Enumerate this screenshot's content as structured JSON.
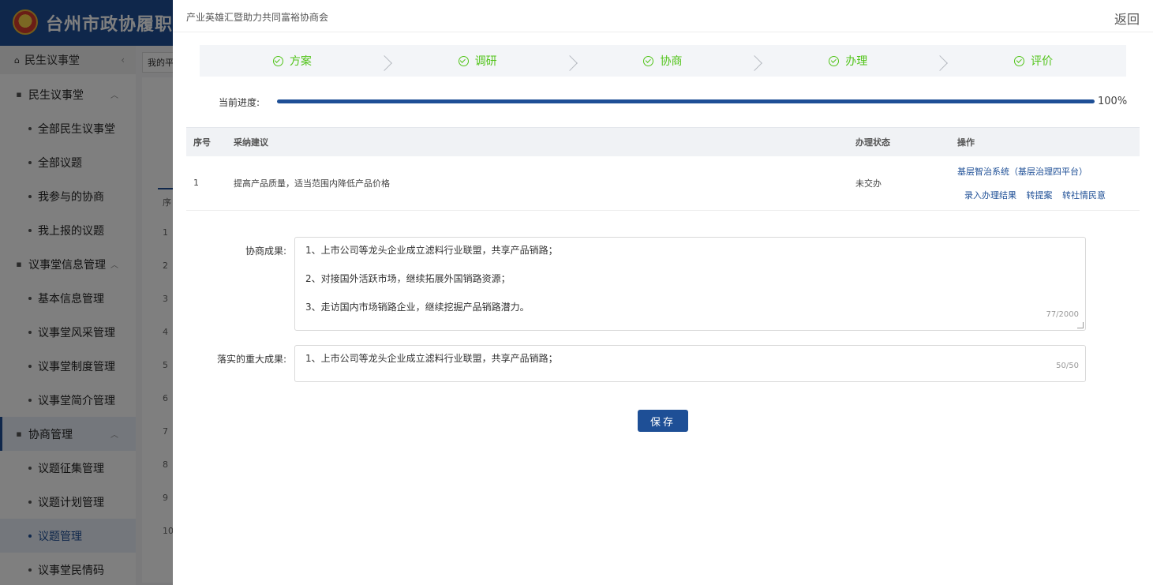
{
  "app": {
    "title": "台州市政协履职服"
  },
  "sidebar": {
    "header": "民生议事堂",
    "items": [
      {
        "type": "group",
        "label": "民生议事堂"
      },
      {
        "type": "sub",
        "label": "全部民生议事堂"
      },
      {
        "type": "sub",
        "label": "全部议题"
      },
      {
        "type": "sub",
        "label": "我参与的协商"
      },
      {
        "type": "sub",
        "label": "我上报的议题"
      },
      {
        "type": "group",
        "label": "议事堂信息管理"
      },
      {
        "type": "sub",
        "label": "基本信息管理"
      },
      {
        "type": "sub",
        "label": "议事堂风采管理"
      },
      {
        "type": "sub",
        "label": "议事堂制度管理"
      },
      {
        "type": "sub",
        "label": "议事堂简介管理"
      },
      {
        "type": "group",
        "label": "协商管理"
      },
      {
        "type": "sub",
        "label": "议题征集管理"
      },
      {
        "type": "sub",
        "label": "议题计划管理"
      },
      {
        "type": "sub",
        "label": "议题管理"
      },
      {
        "type": "sub",
        "label": "议事堂民情码"
      }
    ]
  },
  "background": {
    "tab_label": "我的平",
    "col_header": "序",
    "row_numbers": [
      "1",
      "2",
      "3",
      "4",
      "5",
      "6",
      "7",
      "8",
      "9",
      "10"
    ]
  },
  "drawer": {
    "title": "产业英雄汇暨助力共同富裕协商会",
    "back_label": "返回",
    "steps": [
      "方案",
      "调研",
      "协商",
      "办理",
      "评价"
    ],
    "progress": {
      "label": "当前进度:",
      "value": 100,
      "text": "100%"
    },
    "table": {
      "headers": {
        "index": "序号",
        "suggestion": "采纳建议",
        "status": "办理状态",
        "ops": "操作"
      },
      "rows": [
        {
          "index": "1",
          "suggestion": "提高产品质量，适当范围内降低产品价格",
          "status": "未交办",
          "system": "基层智治系统（基层治理四平台）",
          "actions": [
            "录入办理结果",
            "转提案",
            "转社情民意"
          ]
        }
      ]
    },
    "outcome": {
      "label": "协商成果:",
      "lines": [
        "1、上市公司等龙头企业成立滤料行业联盟，共享产品销路；",
        "2、对接国外活跃市场，继续拓展外国销路资源；",
        "3、走访国内市场销路企业，继续挖掘产品销路潜力。"
      ],
      "count": "77/2000"
    },
    "major": {
      "label": "落实的重大成果:",
      "lines": [
        "1、上市公司等龙头企业成立滤料行业联盟，共享产品销路；"
      ],
      "count": "50/50"
    },
    "save_label": "保存"
  }
}
